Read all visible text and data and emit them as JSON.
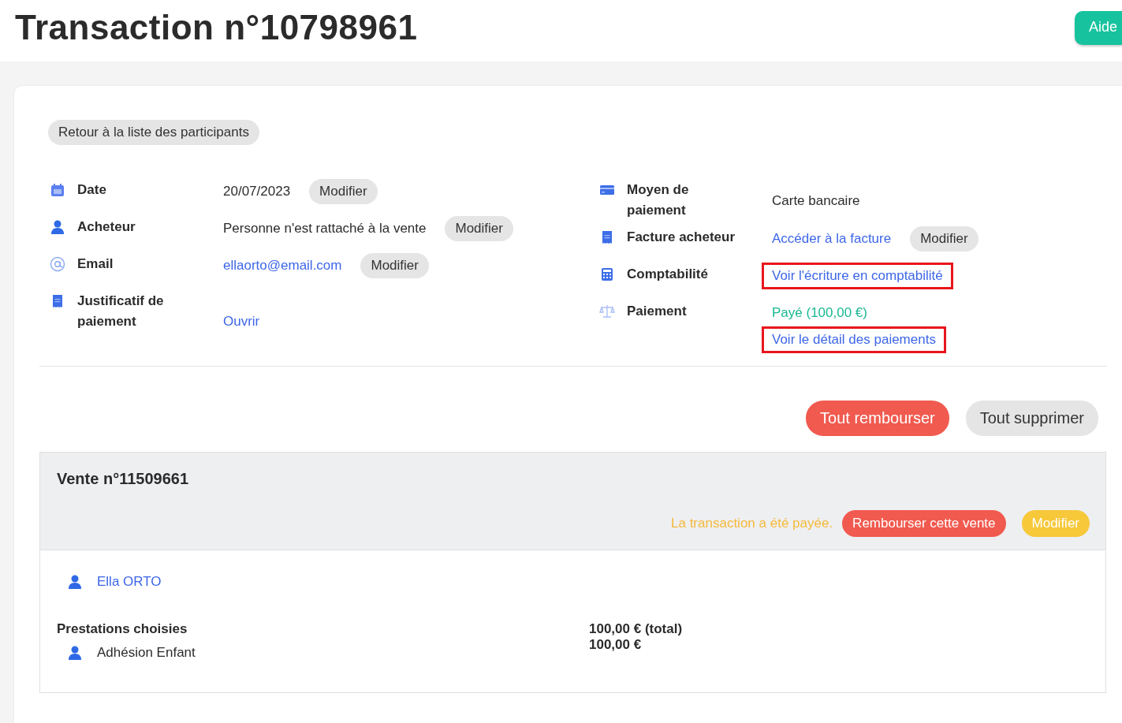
{
  "title": "Transaction n°10798961",
  "help_button": "Aide",
  "back_button": "Retour à la liste des participants",
  "left_fields": [
    {
      "kind": "calendar",
      "label": "Date",
      "value": {
        "kind": "text",
        "text": "20/07/2023"
      },
      "action": "Modifier"
    },
    {
      "kind": "person",
      "label": "Acheteur",
      "value": {
        "kind": "text",
        "text": "Personne n'est rattaché à la vente"
      },
      "action": "Modifier"
    },
    {
      "kind": "email",
      "label": "Email",
      "value": {
        "kind": "link",
        "text": "ellaorto@email.com"
      },
      "action": "Modifier"
    },
    {
      "kind": "receipt",
      "label": "Justificatif de paiement",
      "value": {
        "kind": "link",
        "text": "Ouvrir"
      }
    }
  ],
  "right_fields": [
    {
      "kind": "card",
      "label": "Moyen de paiement",
      "value": {
        "kind": "text",
        "text": "Carte bancaire"
      }
    },
    {
      "kind": "receipt",
      "label": "Facture acheteur",
      "value": {
        "kind": "link",
        "text": "Accéder à la facture"
      },
      "action": "Modifier"
    },
    {
      "kind": "calculator",
      "label": "Comptabilité",
      "value": {
        "kind": "link",
        "text": "Voir l'écriture en comptabilité"
      },
      "highlighted": true
    },
    {
      "kind": "scale",
      "label": "Paiement",
      "value": {
        "kind": "status",
        "text": "Payé (100,00 €)"
      },
      "extra_link": "Voir le détail des paiements",
      "extra_highlighted": true
    }
  ],
  "actions": [
    {
      "label": "Tout rembourser",
      "kind": "danger"
    },
    {
      "label": "Tout supprimer",
      "kind": "neutral"
    }
  ],
  "sale": {
    "title": "Vente n°11509661",
    "status": "La transaction a été payée.",
    "refund_button": "Rembourser cette vente",
    "modify_button": "Modifier",
    "participant": "Ella ORTO",
    "items_heading": "Prestations choisies",
    "items": [
      "Adhésion Enfant"
    ],
    "amounts": [
      "100,00 € (total)",
      "100,00 €"
    ]
  }
}
